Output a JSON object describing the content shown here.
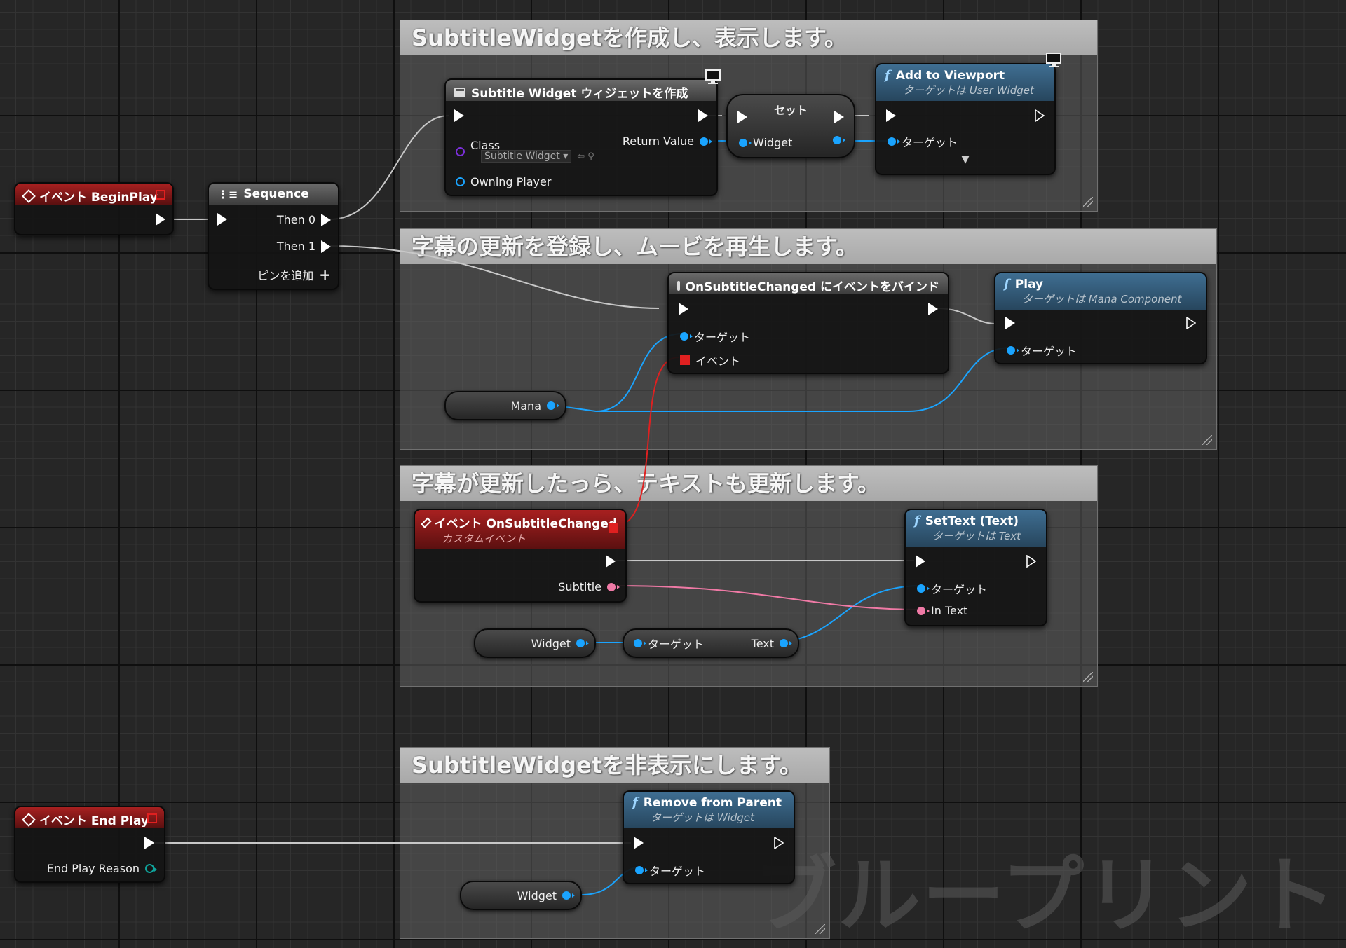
{
  "comments": {
    "c1": "SubtitleWidgetを作成し、表示します。",
    "c2": "字幕の更新を登録し、ムービを再生します。",
    "c3": "字幕が更新したっら、テキストも更新します。",
    "c4": "SubtitleWidgetを非表示にします。"
  },
  "nodes": {
    "begin_play": {
      "title": "イベント BeginPlay"
    },
    "sequence": {
      "title": "Sequence",
      "then0": "Then 0",
      "then1": "Then 1",
      "add_pin": "ピンを追加"
    },
    "create_widget": {
      "title": "Subtitle Widget ウィジェットを作成",
      "class_label": "Class",
      "class_value": "Subtitle Widget",
      "return_value": "Return Value",
      "owning_player": "Owning Player"
    },
    "set": {
      "title": "セット",
      "widget": "Widget"
    },
    "add_to_viewport": {
      "title": "Add to Viewport",
      "subtitle": "ターゲットは User Widget",
      "target": "ターゲット"
    },
    "bind_event": {
      "title": "OnSubtitleChanged にイベントをバインド",
      "target": "ターゲット",
      "event": "イベント"
    },
    "play": {
      "title": "Play",
      "subtitle": "ターゲットは Mana Component",
      "target": "ターゲット"
    },
    "mana_var": {
      "label": "Mana"
    },
    "on_subtitle_changed": {
      "title": "イベント OnSubtitleChanged",
      "subtitle": "カスタムイベント",
      "subtitle_pin": "Subtitle"
    },
    "set_text": {
      "title": "SetText (Text)",
      "subtitle": "ターゲットは Text",
      "target": "ターゲット",
      "in_text": "In Text"
    },
    "widget_var_1": {
      "label": "Widget"
    },
    "get_text": {
      "target": "ターゲット",
      "text": "Text"
    },
    "end_play": {
      "title": "イベント End Play",
      "reason": "End Play Reason"
    },
    "remove_from_parent": {
      "title": "Remove from Parent",
      "subtitle": "ターゲットは Widget",
      "target": "ターゲット"
    },
    "widget_var_2": {
      "label": "Widget"
    }
  },
  "watermark": "ブループリント",
  "colors": {
    "exec_wire": "#c8c8c8",
    "object_pin": "#1aa4ff",
    "text_pin": "#f07aa6",
    "event_delegate": "#e02020",
    "class_pin": "#7a2fd8"
  }
}
